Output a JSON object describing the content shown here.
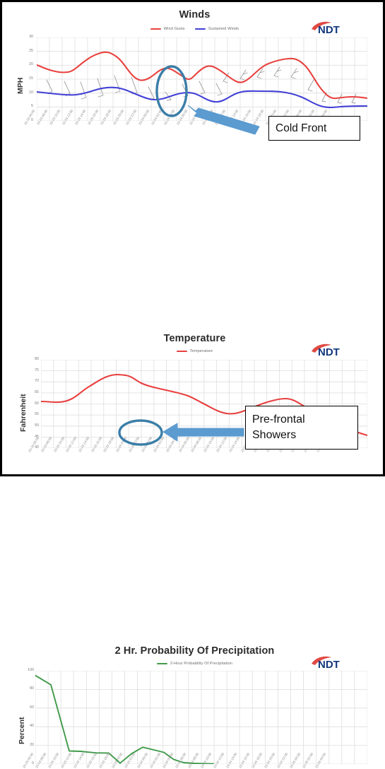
{
  "frame": {
    "border_color": "#000000",
    "background": "#ffffff"
  },
  "branding": {
    "logo_text": "NDT",
    "logo_swoosh_color": "#e04a43",
    "logo_text_color": "#12377e"
  },
  "colors": {
    "wind_gusts": "#e8433f",
    "sustained_winds": "#4240d6",
    "temperature": "#e8403f",
    "precipitation": "#3f9a4a",
    "wind_barb": "#9a9a9a",
    "annotation": "#3b7ea8",
    "grid": "#dcdcdc",
    "axis_text": "#8a8a8a"
  },
  "annotations": [
    {
      "id": "cold-front",
      "label": "Cold Front",
      "lines": [
        "Cold Front"
      ],
      "shape": "ellipse-with-arrow"
    },
    {
      "id": "pre-frontal-showers",
      "label": "Pre-frontal Showers",
      "lines": [
        "Pre-frontal",
        "Showers"
      ],
      "shape": "ellipse-with-arrow"
    }
  ],
  "panels": [
    {
      "id": "winds",
      "title": "Winds"
    },
    {
      "id": "temperature",
      "title": "Temperature"
    },
    {
      "id": "precipitation",
      "title": "2 Hr. Probability Of Precipitation"
    }
  ],
  "chart_data": [
    {
      "id": "winds",
      "type": "line",
      "title": "Winds",
      "xlabel": "",
      "ylabel": "MPH",
      "ylim": [
        0,
        30
      ],
      "yticks": [
        0,
        5,
        10,
        15,
        20,
        25,
        30
      ],
      "grid": true,
      "legend_position": "top-center",
      "x": [
        "10-23 06:00",
        "10-23 08:00",
        "10-23 10:00",
        "10-23 12:00",
        "10-23 14:00",
        "10-23 16:00",
        "10-23 18:00",
        "10-23 20:00",
        "10-23 22:00",
        "10-24 00:00",
        "10-24 02:00",
        "10-24 04:00",
        "10-24 06:00",
        "10-24 08:00",
        "10-24 10:00",
        "10-24 12:00",
        "10-24 14:00",
        "10-24 16:00",
        "10-24 18:00",
        "10-24 20:00",
        "10-24 22:00",
        "10-25 00:00",
        "10-25 02:00",
        "10-25 04:00"
      ],
      "series": [
        {
          "name": "Wind Gusts",
          "color": "#e8433f",
          "values": [
            20.1,
            18.6,
            17.6,
            19.5,
            22.8,
            24.5,
            21.5,
            16.0,
            14.3,
            18.3,
            19.7,
            16.5,
            12.0,
            16.3,
            20.2,
            17.0,
            13.8,
            17.5,
            20.0,
            21.7,
            20.3,
            13.0,
            7.4,
            8.6,
            8.2,
            7.6,
            7.8
          ]
        },
        {
          "name": "Sustained Winds",
          "color": "#4240d6",
          "values": [
            10.5,
            10.1,
            9.4,
            9.6,
            10.8,
            11.8,
            11.6,
            9.5,
            7.6,
            9.3,
            10.3,
            9.3,
            7.0,
            6.4,
            8.6,
            10.1,
            9.1,
            6.9,
            7.8,
            9.2,
            9.9,
            9.6,
            7.5,
            4.0,
            4.7,
            4.8,
            4.6
          ]
        }
      ]
    },
    {
      "id": "temperature",
      "type": "line",
      "title": "Temperature",
      "xlabel": "",
      "ylabel": "Fahrenheit",
      "ylim": [
        40,
        80
      ],
      "yticks": [
        40,
        45,
        50,
        55,
        60,
        65,
        70,
        75,
        80
      ],
      "grid": true,
      "legend_position": "top-center",
      "x": [
        "10-23 06:00",
        "10-23 08:00",
        "10-23 10:00",
        "10-23 12:00",
        "10-23 14:00",
        "10-23 16:00",
        "10-23 18:00",
        "10-23 20:00",
        "10-23 22:00",
        "10-24 00:00",
        "10-24 02:00",
        "10-24 04:00",
        "10-24 06:00",
        "10-24 08:00",
        "10-24 10:00",
        "10-24 12:00",
        "10-24 14:00",
        "10-24 16:00",
        "10-24 18:00",
        "10-24 20:00",
        "10-24 22:00",
        "10-25 00:00",
        "10-25 02:00",
        "10-25 04:00"
      ],
      "series": [
        {
          "name": "Temperature",
          "color": "#e8403f",
          "values": [
            61.0,
            60.9,
            61.5,
            64.5,
            69.0,
            72.0,
            73.0,
            72.4,
            68.8,
            68.0,
            67.0,
            66.2,
            65.2,
            63.2,
            60.0,
            58.0,
            56.3,
            57.2,
            59.4,
            61.2,
            62.2,
            62.0,
            57.0,
            55.4,
            53.0,
            50.5,
            48.2,
            46.5
          ]
        }
      ]
    },
    {
      "id": "precipitation",
      "type": "line",
      "title": "2 Hr. Probability Of Precipitation",
      "xlabel": "",
      "ylabel": "Percent",
      "ylim": [
        0,
        100
      ],
      "yticks": [
        0,
        20,
        40,
        60,
        80,
        100
      ],
      "grid": true,
      "legend_position": "top-center",
      "x": [
        "10-23 06:00",
        "10-23 08:00",
        "10-23 10:00",
        "10-23 12:00",
        "10-23 14:00",
        "10-23 16:00",
        "10-23 18:00",
        "10-23 20:00",
        "10-23 22:00",
        "10-24 00:00",
        "10-24 02:00",
        "10-24 04:00",
        "10-24 06:00",
        "10-24 08:00",
        "10-24 10:00",
        "10-24 12:00",
        "10-24 14:00",
        "10-24 16:00",
        "10-24 18:00",
        "10-24 20:00",
        "10-24 22:00",
        "10-25 00:00",
        "10-25 02:00",
        "10-25 04:00"
      ],
      "series": [
        {
          "name": "2-Hour Probability Of Precipitation",
          "color": "#3f9a4a",
          "values": [
            95.0,
            85.0,
            14.0,
            13.5,
            12.0,
            11.8,
            1.0,
            11.0,
            18.0,
            15.5,
            14.0,
            5.0,
            1.5,
            0.5,
            0.3,
            0.2
          ]
        }
      ]
    }
  ]
}
